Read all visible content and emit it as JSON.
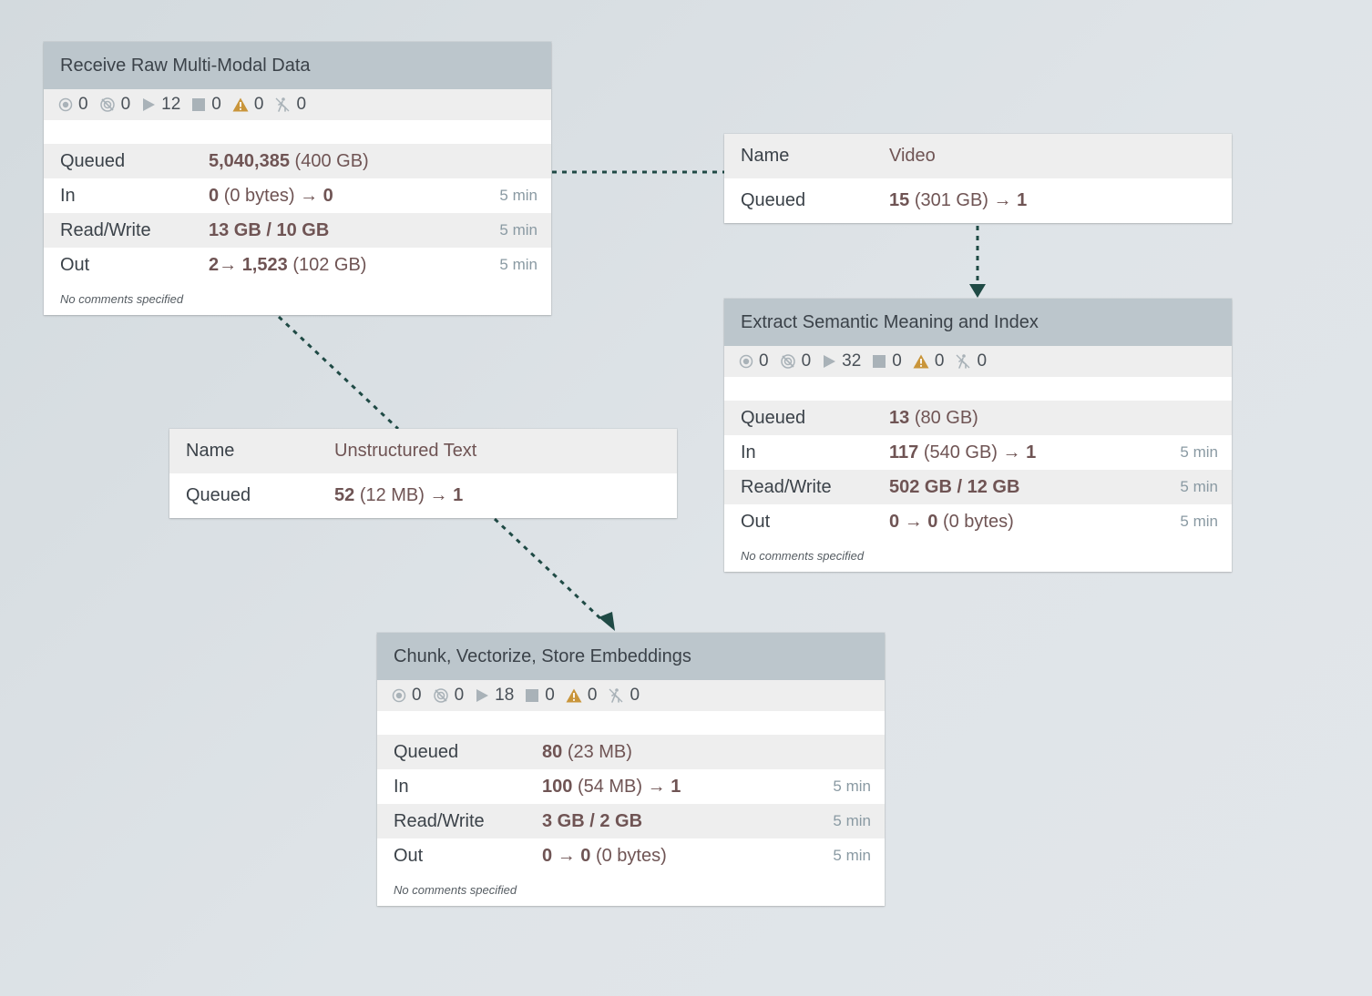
{
  "processors": [
    {
      "title": "Receive Raw Multi-Modal Data",
      "stats": {
        "running": "0",
        "stopped": "0",
        "active": "12",
        "invalid": "0",
        "warnings": "0",
        "disabled": "0"
      },
      "queued": {
        "count": "5,040,385",
        "size": "(400 GB)"
      },
      "in": {
        "count": "0",
        "size": "(0 bytes)",
        "arrow": "→",
        "target": "0",
        "time": "5 min"
      },
      "readwrite": {
        "value": "13 GB / 10 GB",
        "time": "5 min"
      },
      "out": {
        "source": "2",
        "arrow": "→",
        "count": "1,523",
        "size": "(102 GB)",
        "time": "5 min"
      },
      "comments": "No comments specified"
    },
    {
      "title": "Extract Semantic Meaning and Index",
      "stats": {
        "running": "0",
        "stopped": "0",
        "active": "32",
        "invalid": "0",
        "warnings": "0",
        "disabled": "0"
      },
      "queued": {
        "count": "13",
        "size": "(80 GB)"
      },
      "in": {
        "count": "117",
        "size": "(540 GB)",
        "arrow": "→",
        "target": "1",
        "time": "5 min"
      },
      "readwrite": {
        "value": "502 GB / 12 GB",
        "time": "5 min"
      },
      "out": {
        "source": "0",
        "arrow": "→",
        "count": "0",
        "size": "(0 bytes)",
        "time": "5 min"
      },
      "comments": "No comments specified"
    },
    {
      "title": "Chunk, Vectorize, Store Embeddings",
      "stats": {
        "running": "0",
        "stopped": "0",
        "active": "18",
        "invalid": "0",
        "warnings": "0",
        "disabled": "0"
      },
      "queued": {
        "count": "80",
        "size": "(23 MB)"
      },
      "in": {
        "count": "100",
        "size": "(54 MB)",
        "arrow": "→",
        "target": "1",
        "time": "5 min"
      },
      "readwrite": {
        "value": "3 GB / 2 GB",
        "time": "5 min"
      },
      "out": {
        "source": "0",
        "arrow": "→",
        "count": "0",
        "size": "(0 bytes)",
        "time": "5 min"
      },
      "comments": "No comments specified"
    }
  ],
  "connections": [
    {
      "name_label": "Name",
      "name": "Video",
      "queued_label": "Queued",
      "count": "15",
      "size": "(301 GB)",
      "arrow": "→",
      "target": "1"
    },
    {
      "name_label": "Name",
      "name": "Unstructured Text",
      "queued_label": "Queued",
      "count": "52",
      "size": "(12 MB)",
      "arrow": "→",
      "target": "1"
    }
  ],
  "labels": {
    "queued": "Queued",
    "in": "In",
    "readwrite": "Read/Write",
    "out": "Out"
  },
  "colors": {
    "header": "#bcc6cc",
    "row_shade": "#eeeeee",
    "value_text": "#6f5454",
    "time_text": "#8a9aa3",
    "warning": "#c9953a",
    "connector": "#1f4a45"
  }
}
